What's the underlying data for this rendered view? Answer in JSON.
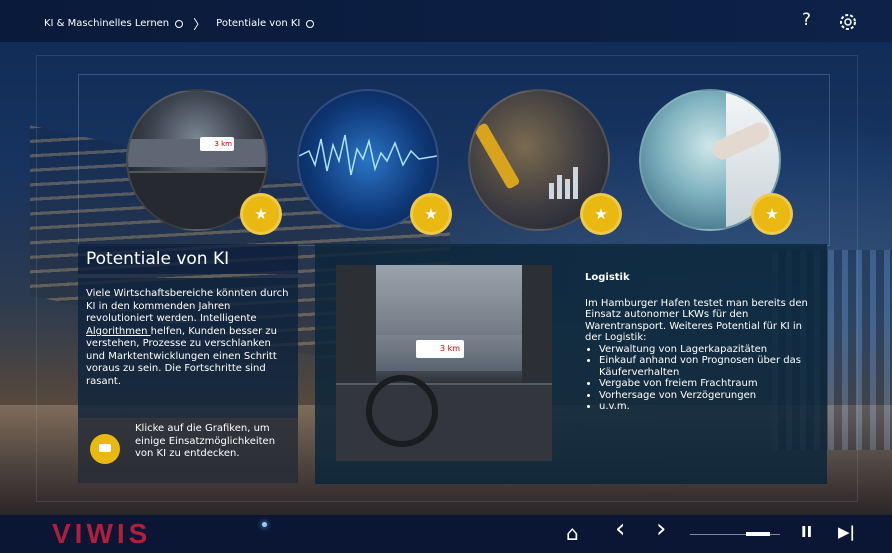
{
  "breadcrumb": {
    "item1": "KI & Maschinelles Lernen",
    "item2": "Potentiale von KI"
  },
  "icons": {
    "help": "?",
    "settings": "gear-icon",
    "star": "★",
    "home": "⌂",
    "prev": "‹",
    "next": "›",
    "pause": "II",
    "skip": "▶|"
  },
  "circles": [
    {
      "name": "autonomous-truck"
    },
    {
      "name": "data-wave"
    },
    {
      "name": "robot-analytics"
    },
    {
      "name": "medical-ai"
    }
  ],
  "truck_sign": "3 km",
  "left_panel": {
    "title": "Potentiale von KI",
    "body_before": "Viele Wirtschaftsbereiche könnten durch KI in den kommenden Jahren revolutioniert werden. Intelligente ",
    "body_link": "Algorithmen ",
    "body_after": "helfen, Kunden besser zu verstehen, Prozesse zu verschlanken und Marktentwicklungen einen Schritt voraus zu sein. Die Fortschritte sind rasant.",
    "hint": "Klicke auf die Grafiken, um einige Einsatzmöglichkeiten von KI zu entdecken."
  },
  "right_panel": {
    "heading": "Logistik",
    "paragraph": "Im Hamburger Hafen testet man bereits den Einsatz autonomer LKWs für den Warentransport. Weiteres Potential für KI in der Logistik:",
    "bullets": [
      "Verwaltung von Lagerkapazitäten",
      "Einkauf anhand von Prognosen über das Käuferverhalten",
      "Vergabe von freiem Frachtraum",
      "Vorhersage von Verzögerungen",
      "u.v.m."
    ]
  },
  "footer": {
    "logo": "VIWIS",
    "progress": 0.75
  },
  "colors": {
    "accent": "#e9b911",
    "logo": "#b0203b",
    "bar": "#0a1633"
  }
}
